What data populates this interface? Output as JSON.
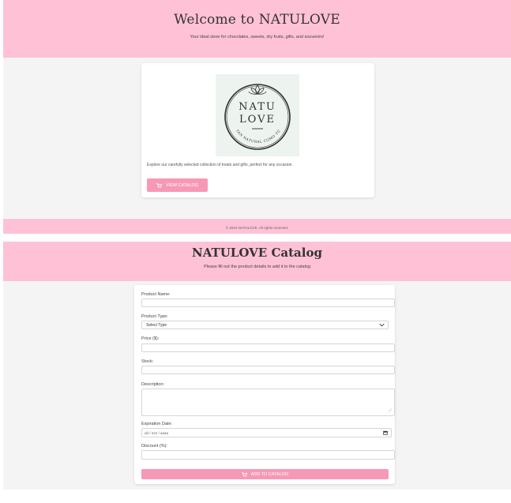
{
  "home": {
    "title": "Welcome to NATULOVE",
    "subtitle": "Your ideal store for chocolates, sweets, dry fruits, gifts, and souvenirs!",
    "logo": {
      "line1": "NATU",
      "line2": "LOVE",
      "tagline": "TAN NATURAL COMO TÚ",
      "icon": "lotus-icon"
    },
    "description": "Explore our carefully selected collection of treats and gifts, perfect for any occasion.",
    "view_catalog_label": "VIEW CATALOG",
    "footer": "© 2024 NATULOVE. All rights reserved."
  },
  "catalog": {
    "title": "NATULOVE Catalog",
    "subtitle": "Please fill out the product details to add it to the catalog",
    "form": {
      "product_name_label": "Product Name:",
      "product_type_label": "Product Type:",
      "product_type_value": "Select Type",
      "price_label": "Price ($):",
      "stock_label": "Stock:",
      "description_label": "Description:",
      "expiration_label": "Expiration Date:",
      "expiration_placeholder": "dd / mm / aaaa",
      "discount_label": "Discount (%):",
      "submit_label": "ADD TO CATALOG"
    }
  },
  "colors": {
    "band": "#ffc1d6",
    "button": "#f799b6",
    "background": "#f4f4f4"
  }
}
